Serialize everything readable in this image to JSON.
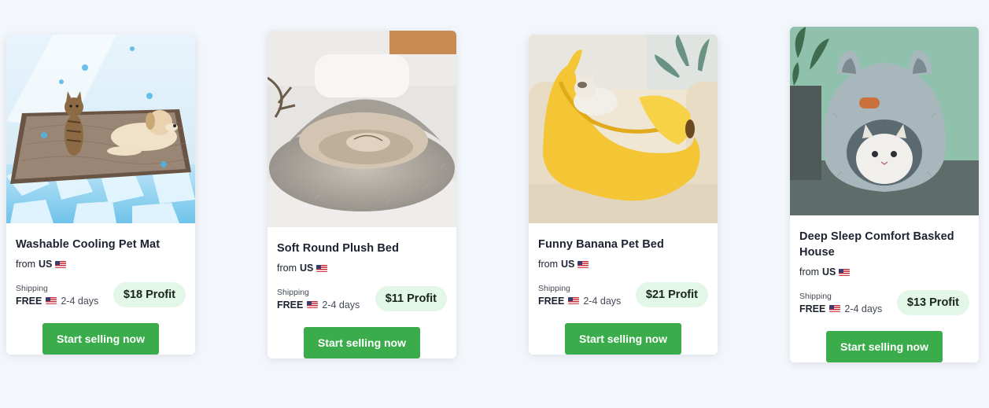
{
  "products": [
    {
      "title": "Washable Cooling Pet Mat",
      "from_prefix": "from",
      "from_country": "US",
      "shipping_label": "Shipping",
      "shipping_free": "FREE",
      "shipping_days": "2-4 days",
      "profit": "$18 Profit",
      "cta": "Start selling now"
    },
    {
      "title": "Soft Round Plush Bed",
      "from_prefix": "from",
      "from_country": "US",
      "shipping_label": "Shipping",
      "shipping_free": "FREE",
      "shipping_days": "2-4 days",
      "profit": "$11 Profit",
      "cta": "Start selling now"
    },
    {
      "title": "Funny Banana Pet Bed",
      "from_prefix": "from",
      "from_country": "US",
      "shipping_label": "Shipping",
      "shipping_free": "FREE",
      "shipping_days": "2-4 days",
      "profit": "$21 Profit",
      "cta": "Start selling now"
    },
    {
      "title": "Deep Sleep Comfort Basked House",
      "from_prefix": "from",
      "from_country": "US",
      "shipping_label": "Shipping",
      "shipping_free": "FREE",
      "shipping_days": "2-4 days",
      "profit": "$13 Profit",
      "cta": "Start selling now"
    }
  ],
  "colors": {
    "background": "#f3f6fb",
    "cta_green": "#3aac4b",
    "profit_badge": "#e3f7e8"
  },
  "icons": {
    "country_flag": "us-flag-icon"
  }
}
